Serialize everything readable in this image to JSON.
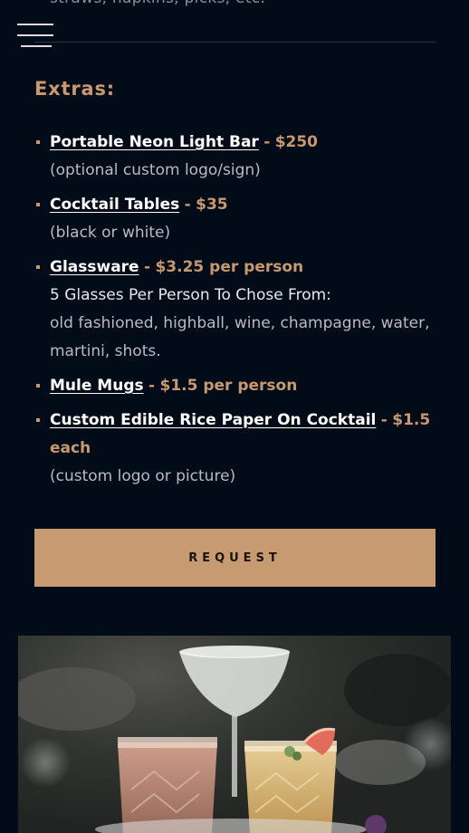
{
  "header": {
    "top_text": "straws, napkins, picks, etc.",
    "menu_icon": "hamburger-menu-icon"
  },
  "extras": {
    "title": "Extras:",
    "items": [
      {
        "name": "Portable Neon Light Bar",
        "separator": "-",
        "price": "$250",
        "note": "(optional custom logo/sign)"
      },
      {
        "name": "Cocktail Tables",
        "separator": "-",
        "price": "$35",
        "note": "(black or white)"
      },
      {
        "name": "Glassware",
        "separator": "-",
        "price": "$3.25 per person",
        "sub": "5 Glasses Per Person To Chose From:",
        "note": "old fashioned, highball, wine, champagne, water, martini, shots."
      },
      {
        "name": "Mule Mugs",
        "separator": "-",
        "price": "$1.5 per person"
      },
      {
        "name": "Custom Edible Rice Paper On Cocktail",
        "separator": "-",
        "price": "$1.5 each",
        "note": "(custom logo or picture)"
      }
    ]
  },
  "request_button": {
    "label": "REQUEST"
  },
  "colors": {
    "background": "#020c18",
    "accent": "#c8996f",
    "button": "#c89a72"
  }
}
